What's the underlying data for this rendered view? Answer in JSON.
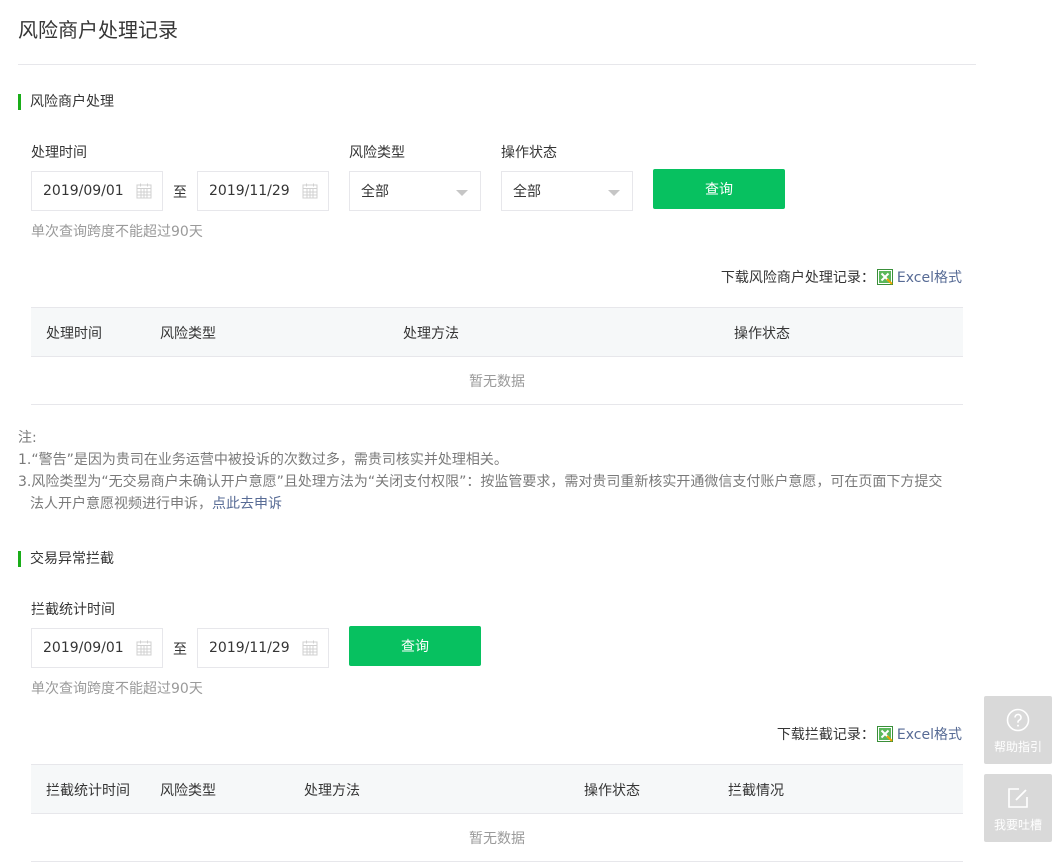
{
  "page": {
    "title": "风险商户处理记录"
  },
  "section1": {
    "title": "风险商户处理",
    "labels": {
      "time": "处理时间",
      "risk_type": "风险类型",
      "op_status": "操作状态"
    },
    "start_date": "2019/09/01",
    "to": "至",
    "end_date": "2019/11/29",
    "risk_type_value": "全部",
    "op_status_value": "全部",
    "query_button": "查询",
    "hint": "单次查询跨度不能超过90天",
    "download_prefix": "下载风险商户处理记录：",
    "download_link": "Excel格式",
    "table": {
      "headers": [
        "处理时间",
        "风险类型",
        "处理方法",
        "操作状态"
      ],
      "empty": "暂无数据"
    }
  },
  "notes": {
    "prefix": "注:",
    "line1": "1.“警告”是因为贵司在业务运营中被投诉的次数过多，需贵司核实并处理相关。",
    "line3a": "3.风险类型为“无交易商户未确认开户意愿”且处理方法为“关闭支付权限”：按监管要求，需对贵司重新核实开通微信支付账户意愿，可在页面下方提交",
    "line3b": "法人开户意愿视频进行申诉，",
    "appeal_link": "点此去申诉"
  },
  "section2": {
    "title": "交易异常拦截",
    "labels": {
      "time": "拦截统计时间"
    },
    "start_date": "2019/09/01",
    "to": "至",
    "end_date": "2019/11/29",
    "query_button": "查询",
    "hint": "单次查询跨度不能超过90天",
    "download_prefix": "下载拦截记录：",
    "download_link": "Excel格式",
    "table": {
      "headers": [
        "拦截统计时间",
        "风险类型",
        "处理方法",
        "操作状态",
        "拦截情况"
      ],
      "empty": "暂无数据"
    }
  },
  "side": {
    "help_label": "帮助指引",
    "feedback_label": "我要吐槽",
    "help_icon": "question-circle-icon",
    "feedback_icon": "edit-icon"
  },
  "colors": {
    "accent": "#07c160",
    "link": "#576b95",
    "section_bar": "#1aad19"
  }
}
